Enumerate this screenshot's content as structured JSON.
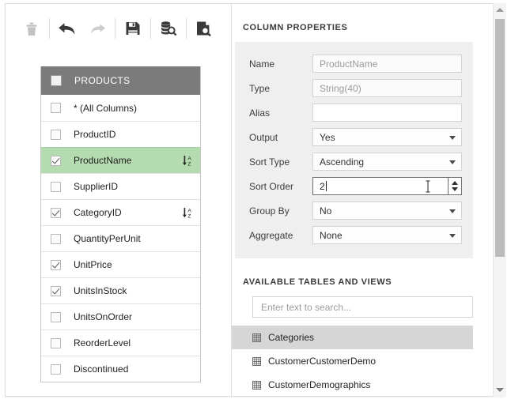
{
  "toolbar": {
    "buttons": [
      {
        "name": "delete-button",
        "icon": "trash-icon",
        "enabled": false
      },
      {
        "name": "undo-button",
        "icon": "undo-arrow-icon",
        "enabled": true
      },
      {
        "name": "redo-button",
        "icon": "redo-arrow-icon",
        "enabled": false
      },
      {
        "name": "save-button",
        "icon": "floppy-disk-icon",
        "enabled": true
      },
      {
        "name": "preview-data-button",
        "icon": "database-search-icon",
        "enabled": true
      },
      {
        "name": "preview-results-button",
        "icon": "document-search-icon",
        "enabled": true
      }
    ]
  },
  "columns_panel": {
    "header_label": "PRODUCTS",
    "header_checked": false,
    "rows": [
      {
        "label": "* (All Columns)",
        "checked": false,
        "sorted": false,
        "selected": false
      },
      {
        "label": "ProductID",
        "checked": false,
        "sorted": false,
        "selected": false
      },
      {
        "label": "ProductName",
        "checked": true,
        "sorted": true,
        "selected": true
      },
      {
        "label": "SupplierID",
        "checked": false,
        "sorted": false,
        "selected": false
      },
      {
        "label": "CategoryID",
        "checked": true,
        "sorted": true,
        "selected": false
      },
      {
        "label": "QuantityPerUnit",
        "checked": false,
        "sorted": false,
        "selected": false
      },
      {
        "label": "UnitPrice",
        "checked": true,
        "sorted": false,
        "selected": false
      },
      {
        "label": "UnitsInStock",
        "checked": true,
        "sorted": false,
        "selected": false
      },
      {
        "label": "UnitsOnOrder",
        "checked": false,
        "sorted": false,
        "selected": false
      },
      {
        "label": "ReorderLevel",
        "checked": false,
        "sorted": false,
        "selected": false
      },
      {
        "label": "Discontinued",
        "checked": false,
        "sorted": false,
        "selected": false
      }
    ]
  },
  "column_properties": {
    "title": "COLUMN PROPERTIES",
    "fields": [
      {
        "label": "Name",
        "value": "ProductName",
        "kind": "readonly"
      },
      {
        "label": "Type",
        "value": "String(40)",
        "kind": "readonly"
      },
      {
        "label": "Alias",
        "value": "",
        "kind": "text"
      },
      {
        "label": "Output",
        "value": "Yes",
        "kind": "dropdown"
      },
      {
        "label": "Sort Type",
        "value": "Ascending",
        "kind": "dropdown"
      },
      {
        "label": "Sort Order",
        "value": "2",
        "kind": "spinner"
      },
      {
        "label": "Group By",
        "value": "No",
        "kind": "dropdown"
      },
      {
        "label": "Aggregate",
        "value": "None",
        "kind": "dropdown"
      }
    ]
  },
  "available_tables": {
    "title": "AVAILABLE TABLES AND VIEWS",
    "search_placeholder": "Enter text to search...",
    "search_value": "",
    "items": [
      {
        "label": "Categories",
        "active": true
      },
      {
        "label": "CustomerCustomerDemo",
        "active": false
      },
      {
        "label": "CustomerDemographics",
        "active": false
      }
    ]
  },
  "scrollbar": {
    "up_icon": "scroll-up-arrow-icon",
    "down_icon": "scroll-down-arrow-icon"
  },
  "colors": {
    "selected_row": "#b4dcb0",
    "header_bar": "#7b7b7b",
    "props_bg": "#efefef",
    "active_item": "#d6d6d6"
  }
}
